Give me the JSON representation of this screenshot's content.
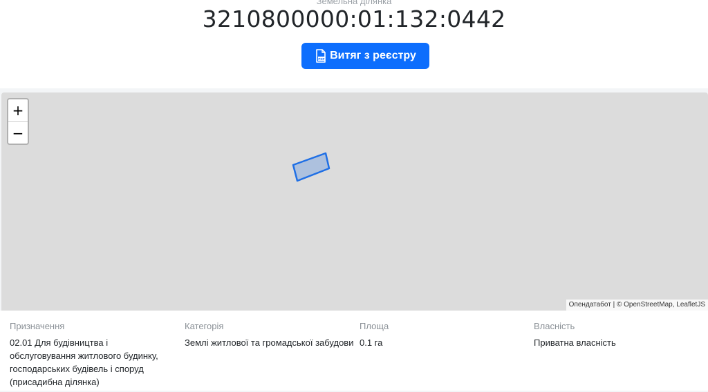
{
  "header": {
    "subtitle": "Земельна ділянка",
    "cadastral_number": "3210800000:01:132:0442",
    "extract_button_label": "Витяг з реєстру"
  },
  "map": {
    "zoom_in": "+",
    "zoom_out": "−",
    "attribution": {
      "source": "Опендатабот",
      "separator": " | © ",
      "osm": "OpenStreetMap",
      "comma": ", ",
      "leaflet": "LeafletJS"
    },
    "parcel_color": "#1f6fe5"
  },
  "details": {
    "purpose_label": "Призначення",
    "purpose_value": "02.01 Для будівництва і обслуговування житлового будинку, господарських будівель і споруд (присадибна ділянка)",
    "category_label": "Категорія",
    "category_value": "Землі житлової та громадської забудови",
    "area_label": "Площа",
    "area_value": "0.1 га",
    "ownership_label": "Власність",
    "ownership_value": "Приватна власність"
  }
}
